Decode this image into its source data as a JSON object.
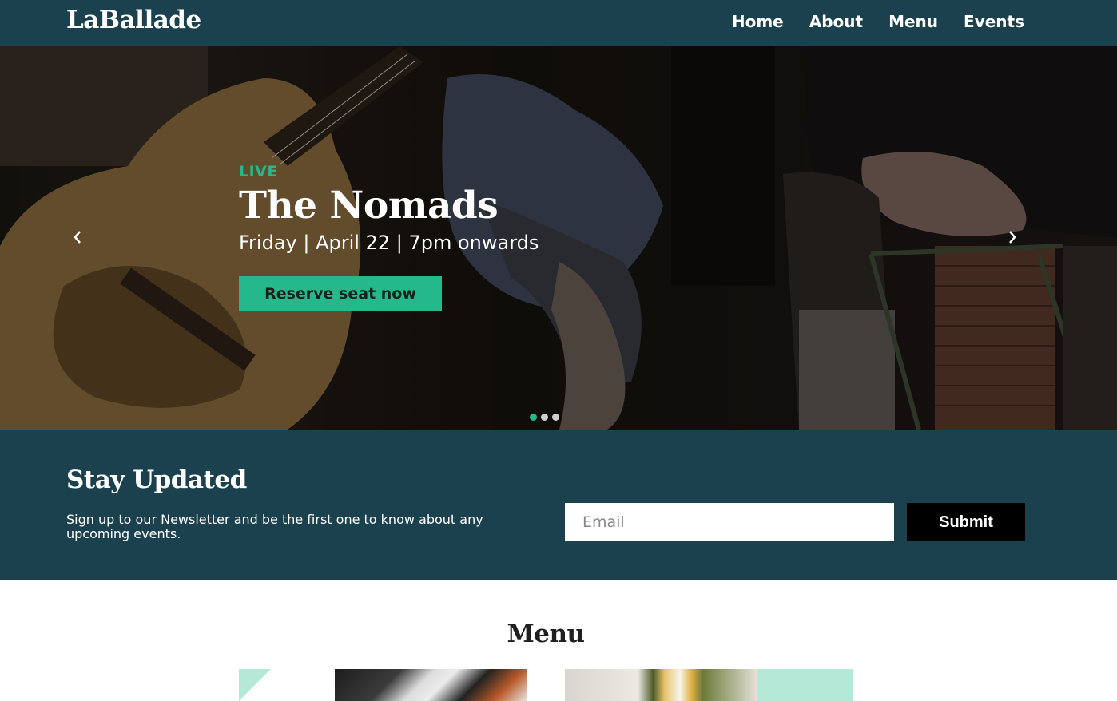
{
  "header": {
    "brand": "LaBallade",
    "nav": [
      "Home",
      "About",
      "Menu",
      "Events"
    ]
  },
  "hero": {
    "tag": "LIVE",
    "title": "The Nomads",
    "details": "Friday | April 22 | 7pm onwards",
    "cta": "Reserve seat now",
    "slides": {
      "count": 3,
      "active": 1
    },
    "prev_icon": "chevron-left-icon",
    "next_icon": "chevron-right-icon"
  },
  "newsletter": {
    "title": "Stay Updated",
    "text": "Sign up to our Newsletter and be the first one to know about any upcoming events.",
    "email_placeholder": "Email",
    "submit": "Submit"
  },
  "menu": {
    "heading": "Menu"
  },
  "colors": {
    "primary": "#1c414e",
    "accent": "#25b88a",
    "mint": "#b6e8d8"
  }
}
